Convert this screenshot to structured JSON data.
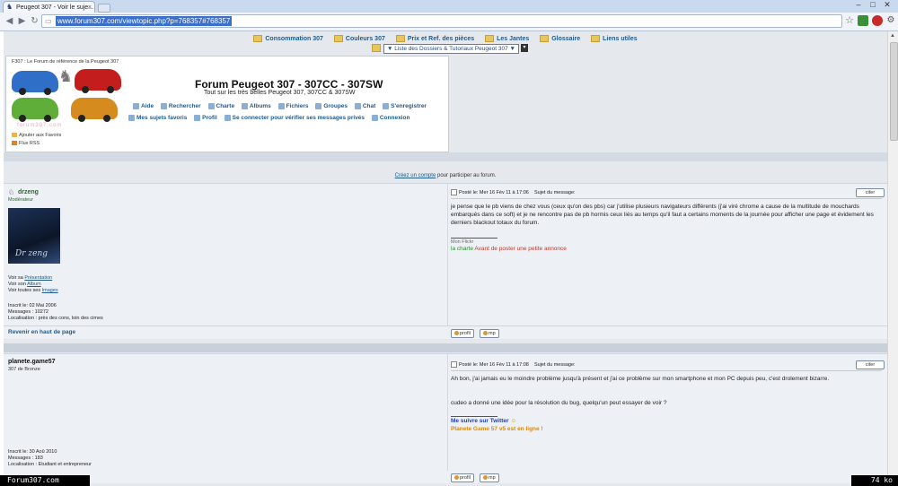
{
  "browser": {
    "tab_title": "Peugeot 307 - Voir le suje...",
    "url": "www.forum307.com/viewtopic.php?p=768357#768357"
  },
  "forum": {
    "top_links": [
      "Consommation 307",
      "Couleurs 307",
      "Prix et Ref. des pièces",
      "Les Jantes",
      "Glossaire",
      "Liens utiles"
    ],
    "dossier_select": "▼ Liste des Dossiers & Tutoriaux Peugeot 307 ▼",
    "tagline": "F307 : Le Forum de référence de la Peugeot 307",
    "title": "Forum Peugeot 307 - 307CC - 307SW",
    "subtitle": "Tout sur les très belles Peugeot 307, 307CC & 307SW",
    "menu_row1": [
      "Aide",
      "Rechercher",
      "Charte",
      "Albums",
      "Fichiers",
      "Groupes",
      "Chat",
      "S'enregistrer"
    ],
    "menu_row2": [
      "Mes sujets favoris",
      "Profil",
      "Se connecter pour vérifier ses messages privés",
      "Connexion"
    ],
    "favorites_link": "Ajouter aux Favoris",
    "rss_link": "Flux RSS",
    "watermark": "forum307.com",
    "signup_link": "Créez un compte",
    "signup_text": " pour participer au forum."
  },
  "posts": [
    {
      "username": "drzeng",
      "role": "Modérateur",
      "avatar_text": "Dr zeng",
      "links": [
        {
          "prefix": "Voir sa ",
          "link": "Présentation"
        },
        {
          "prefix": "Voir son ",
          "link": "Album"
        },
        {
          "prefix": "Voir toutes ses ",
          "link": "Images"
        }
      ],
      "registered": "Inscrit le: 02 Mai 2006",
      "messages": "Messages : 10272",
      "location": "Localisation : près des cons, loin des cimes",
      "posted": "Posté le: Mer 16 Fév 11 à 17:06",
      "subject": "Sujet du message:",
      "quote_label": "citer",
      "body": "je pense que le pb viens de chez vous (ceux qu'on des pbs) car j'utilise plusieurs navigateurs différents (j'ai viré chrome a cause de la multitude de mouchards embarqués dans ce soft) et je ne rencontre pas de pb hormis ceux liés au temps qu'il faut a certains moments de la journée pour afficher une page et évidement les derniers blackout totaux du forum.",
      "sig_small": "Mon Flickr",
      "sig_charte": "la charte",
      "sig_annonce": " Avant de poster une petite annonce",
      "back_to_top": "Revenir en haut de page",
      "profile_btn": "profil",
      "pm_btn": "mp"
    },
    {
      "username": "planete.game57",
      "role": "307 de Bronze",
      "registered": "Inscrit le: 30 Aoû 2010",
      "messages": "Messages : 183",
      "location": "Localisation : Etudiant et entrepreneur",
      "posted": "Posté le: Mer 16 Fév 11 à 17:08",
      "subject": "Sujet du message:",
      "quote_label": "citer",
      "body1": "Ah bon, j'ai jamais eu le moindre problème jusqu'à présent et j'ai ce problème sur mon smartphone et mon PC depuis peu, c'est drolement bizarre.",
      "body2": "cudeo a donné une idée pour la résolution du bug, quelqu'un peut essayer de voir ?",
      "sig1": "Me suivre sur Twitter",
      "sig2": "Planete Game 57 v5 est en ligne !",
      "profile_btn": "profil",
      "pm_btn": "mp"
    }
  ],
  "overlay": {
    "left": "Forum307.com",
    "right": "74 ko"
  }
}
